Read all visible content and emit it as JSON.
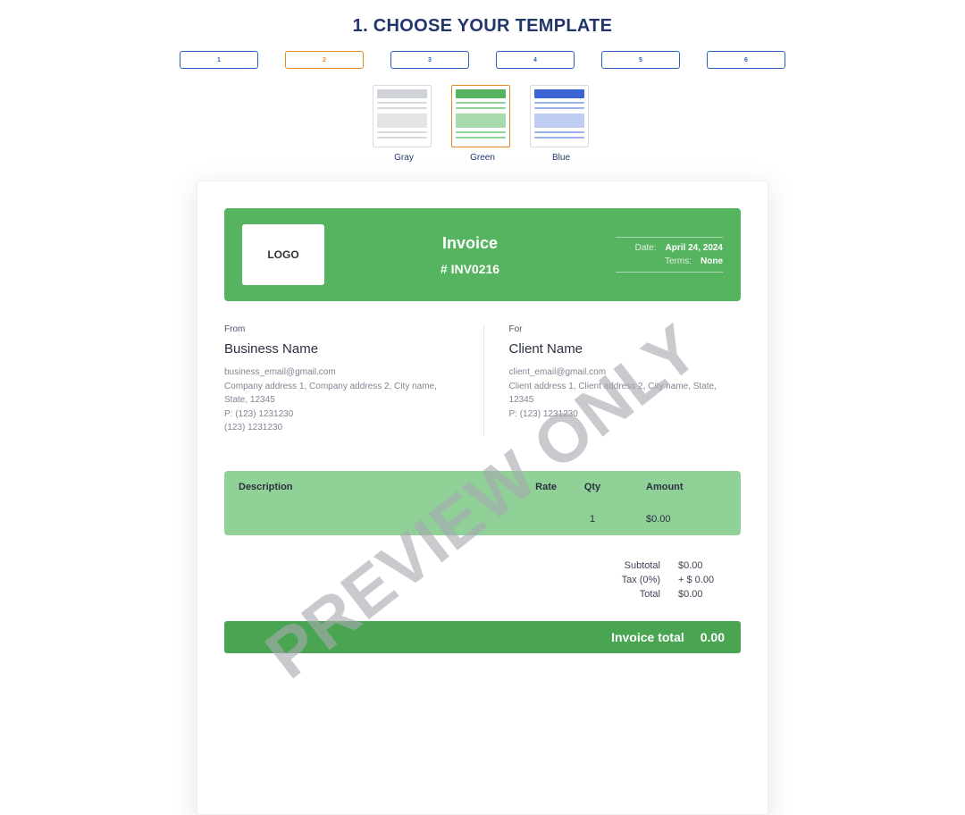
{
  "heading": "1. CHOOSE YOUR TEMPLATE",
  "steps": [
    "1",
    "2",
    "3",
    "4",
    "5",
    "6"
  ],
  "active_step_index": 1,
  "swatches": [
    {
      "id": "gray",
      "label": "Gray"
    },
    {
      "id": "green",
      "label": "Green"
    },
    {
      "id": "blue",
      "label": "Blue"
    }
  ],
  "active_swatch_index": 1,
  "watermark": "PREVIEW ONLY",
  "invoice": {
    "logo_text": "LOGO",
    "title": "Invoice",
    "number": "# INV0216",
    "meta": {
      "date_label": "Date:",
      "date_value": "April 24, 2024",
      "terms_label": "Terms:",
      "terms_value": "None"
    },
    "from": {
      "section": "From",
      "name": "Business Name",
      "email": "business_email@gmail.com",
      "address": "Company address 1, Company address 2, City name, State, 12345",
      "phone1": "P: (123) 1231230",
      "phone2": "(123) 1231230"
    },
    "for": {
      "section": "For",
      "name": "Client Name",
      "email": "client_email@gmail.com",
      "address": "Client address 1, Client address 2, City name, State, 12345",
      "phone1": "P: (123) 1231230"
    },
    "columns": {
      "desc": "Description",
      "rate": "Rate",
      "qty": "Qty",
      "amount": "Amount"
    },
    "items": [
      {
        "desc": "",
        "rate": "",
        "qty": "1",
        "amount": "$0.00"
      }
    ],
    "subtotals": {
      "subtotal_label": "Subtotal",
      "subtotal_value": "$0.00",
      "tax_label": "Tax (0%)",
      "tax_value": "+ $ 0.00",
      "total_label": "Total",
      "total_value": "$0.00"
    },
    "grand": {
      "label": "Invoice total",
      "value": "0.00"
    }
  }
}
